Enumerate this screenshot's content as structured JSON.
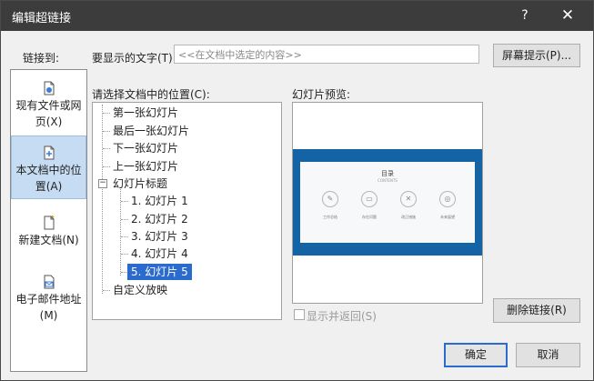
{
  "window": {
    "title": "编辑超链接",
    "help_label": "?",
    "close_label": "✕"
  },
  "link_to": {
    "label": "链接到:",
    "items": [
      {
        "icon": "existing-file-icon",
        "label_line1": "现有文件或网",
        "label_line2": "页(X)"
      },
      {
        "icon": "place-in-document-icon",
        "label_line1": "本文档中的位",
        "label_line2": "置(A)",
        "selected": true
      },
      {
        "icon": "new-document-icon",
        "label_line1": "新建文档(N)",
        "label_line2": ""
      },
      {
        "icon": "email-address-icon",
        "label_line1": "电子邮件地址",
        "label_line2": "(M)"
      }
    ]
  },
  "display_text": {
    "label": "要显示的文字(T):",
    "value": "<<在文档中选定的内容>>"
  },
  "screentip_button": "屏幕提示(P)...",
  "select_place": {
    "label": "请选择文档中的位置(C):",
    "items": [
      {
        "label": "第一张幻灯片"
      },
      {
        "label": "最后一张幻灯片"
      },
      {
        "label": "下一张幻灯片"
      },
      {
        "label": "上一张幻灯片"
      },
      {
        "label": "幻灯片标题",
        "expander": "−"
      },
      {
        "label": "1. 幻灯片 1"
      },
      {
        "label": "2. 幻灯片 2"
      },
      {
        "label": "3. 幻灯片 3"
      },
      {
        "label": "4. 幻灯片 4"
      },
      {
        "label": "5. 幻灯片 5",
        "selected": true
      },
      {
        "label": "自定义放映"
      }
    ]
  },
  "preview": {
    "label": "幻灯片预览:",
    "slide_title": "目录",
    "slide_subtitle": "CONTENTS",
    "items": [
      "工作总结",
      "存在问题",
      "改正措施",
      "未来展望"
    ]
  },
  "show_and_return": {
    "label": "显示并返回(S)",
    "checked": false
  },
  "remove_link_button": "删除链接(R)",
  "ok_button": "确定",
  "cancel_button": "取消",
  "colors": {
    "title_bar": "#3c3c3c",
    "selection": "#2b6bcd",
    "slide_border": "#1464a5"
  }
}
